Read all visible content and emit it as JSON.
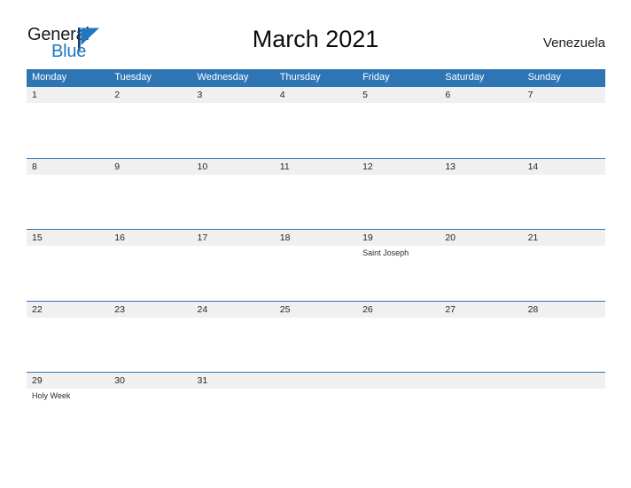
{
  "brand": {
    "name_part1": "General",
    "name_part2": "Blue",
    "flag_icon": "blue-flag-triangle",
    "color_dark": "#1a1a1a",
    "color_blue": "#1f78c1"
  },
  "header": {
    "title": "March 2021",
    "country": "Venezuela"
  },
  "colors": {
    "header_blue": "#2e75b6",
    "row_band_gray": "#f0f0f0",
    "text_dark": "#262626",
    "background": "#ffffff"
  },
  "weekdays": [
    "Monday",
    "Tuesday",
    "Wednesday",
    "Thursday",
    "Friday",
    "Saturday",
    "Sunday"
  ],
  "weeks": [
    [
      {
        "day": "1",
        "event": ""
      },
      {
        "day": "2",
        "event": ""
      },
      {
        "day": "3",
        "event": ""
      },
      {
        "day": "4",
        "event": ""
      },
      {
        "day": "5",
        "event": ""
      },
      {
        "day": "6",
        "event": ""
      },
      {
        "day": "7",
        "event": ""
      }
    ],
    [
      {
        "day": "8",
        "event": ""
      },
      {
        "day": "9",
        "event": ""
      },
      {
        "day": "10",
        "event": ""
      },
      {
        "day": "11",
        "event": ""
      },
      {
        "day": "12",
        "event": ""
      },
      {
        "day": "13",
        "event": ""
      },
      {
        "day": "14",
        "event": ""
      }
    ],
    [
      {
        "day": "15",
        "event": ""
      },
      {
        "day": "16",
        "event": ""
      },
      {
        "day": "17",
        "event": ""
      },
      {
        "day": "18",
        "event": ""
      },
      {
        "day": "19",
        "event": "Saint Joseph"
      },
      {
        "day": "20",
        "event": ""
      },
      {
        "day": "21",
        "event": ""
      }
    ],
    [
      {
        "day": "22",
        "event": ""
      },
      {
        "day": "23",
        "event": ""
      },
      {
        "day": "24",
        "event": ""
      },
      {
        "day": "25",
        "event": ""
      },
      {
        "day": "26",
        "event": ""
      },
      {
        "day": "27",
        "event": ""
      },
      {
        "day": "28",
        "event": ""
      }
    ],
    [
      {
        "day": "29",
        "event": "Holy Week"
      },
      {
        "day": "30",
        "event": ""
      },
      {
        "day": "31",
        "event": ""
      },
      {
        "day": "",
        "event": ""
      },
      {
        "day": "",
        "event": ""
      },
      {
        "day": "",
        "event": ""
      },
      {
        "day": "",
        "event": ""
      }
    ]
  ]
}
